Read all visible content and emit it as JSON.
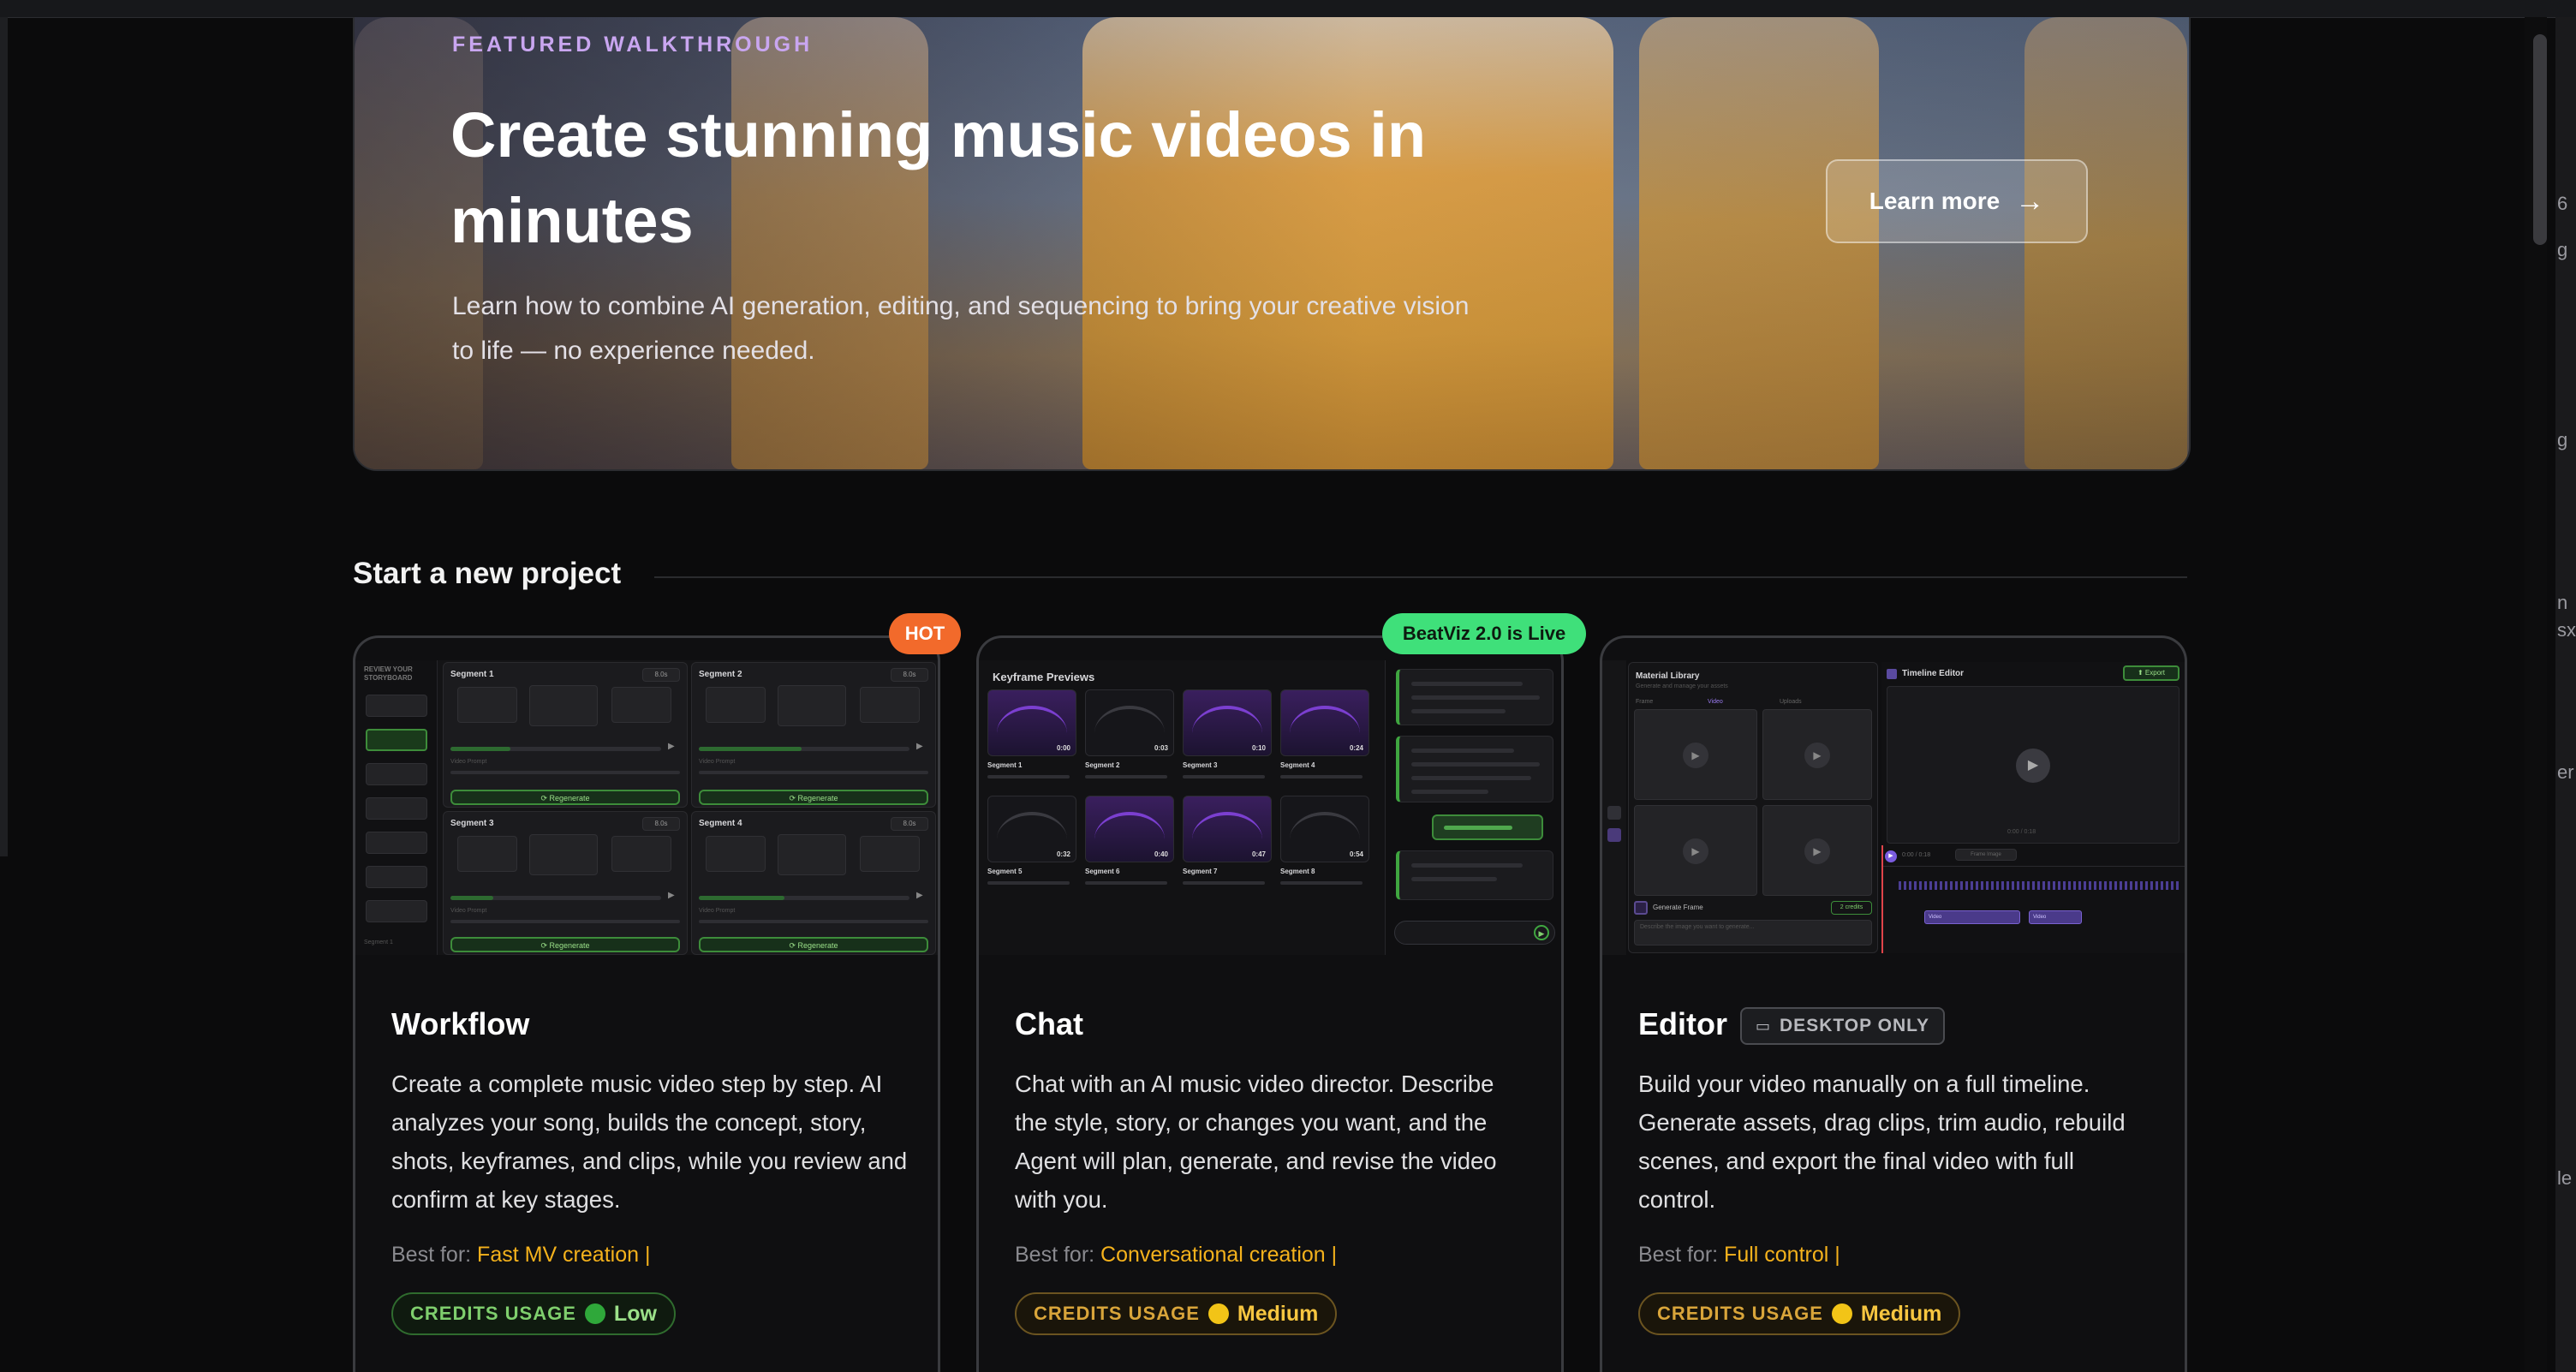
{
  "hero": {
    "eyebrow": "FEATURED WALKTHROUGH",
    "title": "Create stunning music videos in minutes",
    "subtitle": "Learn how to combine AI generation, editing, and sequencing to bring your creative vision to life — no experience needed.",
    "cta_label": "Learn more",
    "cta_icon": "arrow-right-icon"
  },
  "section": {
    "title": "Start a new project"
  },
  "badges": {
    "hot": "HOT",
    "live": "BeatViz 2.0 is Live"
  },
  "cards": [
    {
      "title": "Workflow",
      "description": "Create a complete music video step by step. AI analyzes your song, builds the concept, story, shots, keyframes, and clips, while you review and confirm at key stages.",
      "best_for_label": "Best for:",
      "best_for_value": "Fast MV creation",
      "credits_label": "CREDITS USAGE",
      "credits_level": "Low",
      "credits_color": "#2fa83a",
      "preview": {
        "sidebar_title": "REVIEW YOUR STORYBOARD",
        "segments": [
          "Segment 1",
          "Segment 2",
          "Segment 3",
          "Segment 4"
        ],
        "durations": [
          "8.0s",
          "8.0s",
          "8.0s",
          "8.0s"
        ],
        "regen_label": "Regenerate",
        "prompt_label": "Video Prompt",
        "footer": "Segment 1"
      }
    },
    {
      "title": "Chat",
      "description": "Chat with an AI music video director. Describe the style, story, or changes you want, and the Agent will plan, generate, and revise the video with you.",
      "best_for_label": "Best for:",
      "best_for_value": "Conversational creation",
      "credits_label": "CREDITS USAGE",
      "credits_level": "Medium",
      "credits_color": "#f2c417",
      "preview": {
        "title": "Keyframe Previews",
        "segments": [
          "Segment 1",
          "Segment 2",
          "Segment 3",
          "Segment 4",
          "Segment 5",
          "Segment 6",
          "Segment 7",
          "Segment 8"
        ],
        "times": [
          "0:00",
          "0:03",
          "0:10",
          "0:24",
          "0:32",
          "0:40",
          "0:47",
          "0:54"
        ]
      }
    },
    {
      "title": "Editor",
      "tag": "DESKTOP ONLY",
      "tag_icon": "monitor-icon",
      "description": "Build your video manually on a full timeline. Generate assets, drag clips, trim audio, rebuild scenes, and export the final video with full control.",
      "best_for_label": "Best for:",
      "best_for_value": "Full control",
      "credits_label": "CREDITS USAGE",
      "credits_level": "Medium",
      "credits_color": "#f2c417",
      "preview": {
        "library_title": "Material Library",
        "library_sub": "Generate and manage your assets",
        "library_tabs": [
          "Frame",
          "Video",
          "Uploads"
        ],
        "timeline_title": "Timeline Editor",
        "export_label": "Export",
        "generate_label": "Generate Frame",
        "credits_small": "2 credits",
        "prompt_placeholder": "Describe the image you want to generate...",
        "timecode": "0:00 / 0:18",
        "time_readout": "0:00 / 0:18",
        "zoom_label": "Frame Image",
        "clip_labels": [
          "Video",
          "Video"
        ]
      }
    }
  ],
  "sidebar_fragments": [
    "6",
    "g",
    "g",
    "n",
    "sx",
    "er",
    "le"
  ]
}
